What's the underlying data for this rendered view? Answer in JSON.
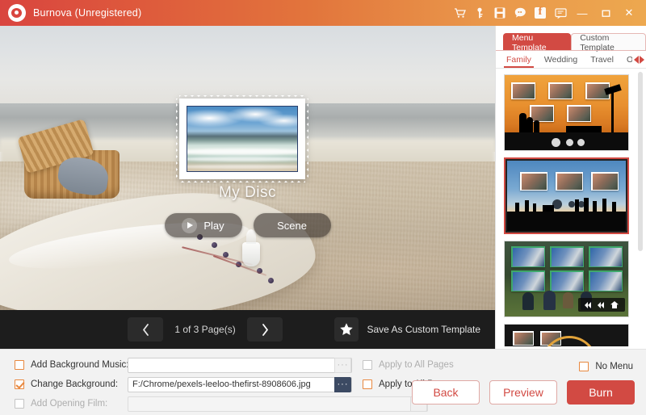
{
  "titlebar": {
    "app_title": "Burnova (Unregistered)",
    "logo_icon": "burnova-disc-logo",
    "icons": [
      {
        "name": "cart-icon",
        "glyph": "cart"
      },
      {
        "name": "key-icon",
        "glyph": "key"
      },
      {
        "name": "save-icon",
        "glyph": "save"
      },
      {
        "name": "support-chat-icon",
        "glyph": "chat"
      },
      {
        "name": "facebook-icon",
        "glyph": "facebook"
      },
      {
        "name": "feedback-icon",
        "glyph": "feedback"
      }
    ],
    "minimize_label": "—",
    "maximize_label": "▫",
    "close_label": "✕",
    "gradient_from": "#d9453f",
    "gradient_to": "#eda84f"
  },
  "stage": {
    "disc_title": "My Disc",
    "play_label": "Play",
    "scene_label": "Scene",
    "play_icon": "play-triangle-icon",
    "thumbnail_alt": "ocean-waves-photo-in-stamp-frame"
  },
  "toolstrip": {
    "prev_icon": "chevron-left-icon",
    "next_icon": "chevron-right-icon",
    "page_label": "1 of 3 Page(s)",
    "star_icon": "star-icon",
    "save_template_label": "Save As Custom Template"
  },
  "right_panel": {
    "tabs": [
      {
        "label": "Menu Template",
        "active": true
      },
      {
        "label": "Custom Template",
        "active": false
      }
    ],
    "subtabs": [
      {
        "label": "Family",
        "active": true
      },
      {
        "label": "Wedding",
        "active": false
      },
      {
        "label": "Travel",
        "active": false
      },
      {
        "label": "Others",
        "active": false
      }
    ],
    "scroll_left_icon": "triangle-left-icon",
    "scroll_right_icon": "triangle-right-icon",
    "templates": [
      {
        "name": "sunset-family-silhouette-template",
        "selected": false,
        "photo_slots": 5
      },
      {
        "name": "blue-beach-silhouette-template",
        "selected": true,
        "photo_slots": 3
      },
      {
        "name": "forest-meadow-children-template",
        "selected": false,
        "photo_slots": 6
      },
      {
        "name": "dark-arc-template",
        "selected": false,
        "photo_slots": 2
      }
    ],
    "accent_color": "#d24a43"
  },
  "bottom": {
    "rows": [
      {
        "name": "add-background-music",
        "label": "Add Background Music:",
        "checked": false,
        "disabled": false,
        "value": "",
        "browse_label": "···",
        "apply_label": "Apply to All Pages",
        "apply_checked": false,
        "apply_disabled": true
      },
      {
        "name": "change-background",
        "label": "Change Background:",
        "checked": true,
        "disabled": false,
        "value": "F:/Chrome/pexels-leeloo-thefirst-8908606.jpg",
        "browse_label": "···",
        "apply_label": "Apply to All Pages",
        "apply_checked": false,
        "apply_disabled": false
      },
      {
        "name": "add-opening-film",
        "label": "Add Opening Film:",
        "checked": false,
        "disabled": true,
        "value": "",
        "browse_label": "···"
      }
    ],
    "no_menu_label": "No Menu",
    "no_menu_checked": false,
    "back_label": "Back",
    "preview_label": "Preview",
    "burn_label": "Burn",
    "accent_color": "#d24a43",
    "checkbox_color": "#e8883f"
  }
}
